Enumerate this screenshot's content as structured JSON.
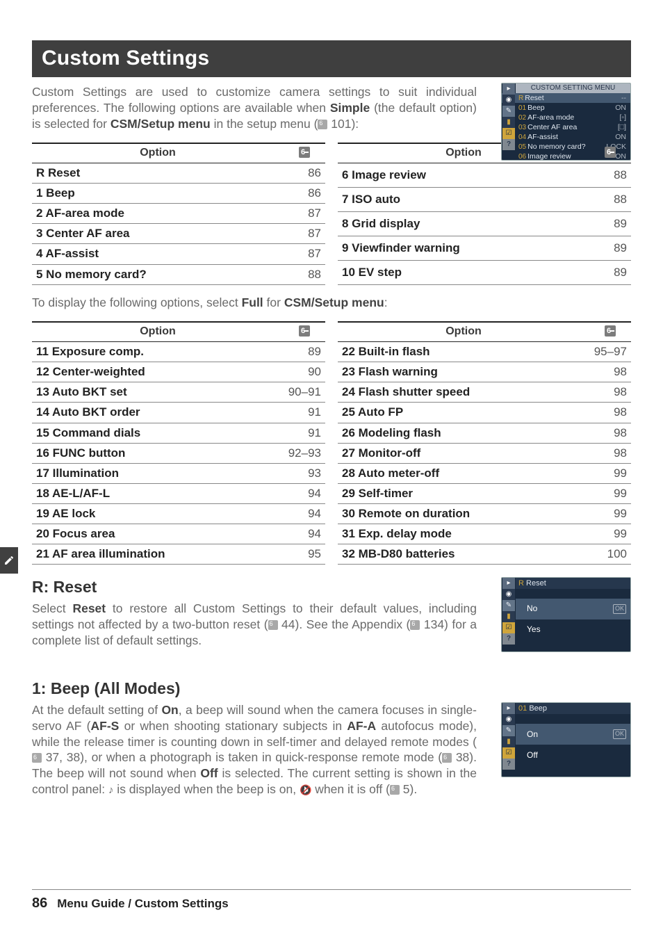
{
  "title": "Custom Settings",
  "intro_parts": {
    "p1": "Custom Settings are used to customize camera settings to suit individual preferences.  The following options are available when ",
    "p1b": "Simple",
    "p2": " (the default option) is selected for ",
    "p2b": "CSM/Setup menu",
    "p3": " in the setup menu (",
    "p3ref": " 101):"
  },
  "lcd1": {
    "title": "CUSTOM SETTING MENU",
    "rows": [
      {
        "n": "R",
        "label": "Reset",
        "val": "--"
      },
      {
        "n": "01",
        "label": "Beep",
        "val": "ON"
      },
      {
        "n": "02",
        "label": "AF-area mode",
        "val": "[▫]"
      },
      {
        "n": "03",
        "label": "Center AF area",
        "val": "[□]"
      },
      {
        "n": "04",
        "label": "AF-assist",
        "val": "ON"
      },
      {
        "n": "05",
        "label": "No memory card?",
        "val": "LOCK"
      },
      {
        "n": "06",
        "label": "Image review",
        "val": "ON"
      }
    ]
  },
  "table_head": {
    "opt": "Option"
  },
  "simple_left": [
    {
      "label": "R Reset",
      "pg": "86"
    },
    {
      "label": "1 Beep",
      "pg": "86"
    },
    {
      "label": "2 AF-area mode",
      "pg": "87"
    },
    {
      "label": "3 Center AF area",
      "pg": "87"
    },
    {
      "label": "4 AF-assist",
      "pg": "87"
    },
    {
      "label": "5 No memory card?",
      "pg": "88"
    }
  ],
  "simple_right": [
    {
      "label": "6 Image review",
      "pg": "88"
    },
    {
      "label": "7 ISO auto",
      "pg": "88"
    },
    {
      "label": "8 Grid display",
      "pg": "89"
    },
    {
      "label": "9 Viewfinder warning",
      "pg": "89"
    },
    {
      "label": "10 EV step",
      "pg": "89"
    }
  ],
  "midline": {
    "p1": "To display the following options, select ",
    "b1": "Full",
    "p2": " for ",
    "b2": "CSM/Setup menu",
    "p3": ":"
  },
  "full_left": [
    {
      "label": "11 Exposure comp.",
      "pg": "89"
    },
    {
      "label": "12 Center-weighted",
      "pg": "90"
    },
    {
      "label": "13 Auto BKT set",
      "pg": "90–91"
    },
    {
      "label": "14 Auto BKT order",
      "pg": "91"
    },
    {
      "label": "15 Command dials",
      "pg": "91"
    },
    {
      "label": "16 FUNC button",
      "pg": "92–93"
    },
    {
      "label": "17 Illumination",
      "pg": "93"
    },
    {
      "label": "18 AE-L/AF-L",
      "pg": "94"
    },
    {
      "label": "19 AE lock",
      "pg": "94"
    },
    {
      "label": "20 Focus area",
      "pg": "94"
    },
    {
      "label": "21 AF area illumination",
      "pg": "95"
    }
  ],
  "full_right": [
    {
      "label": "22 Built-in flash",
      "pg": "95–97"
    },
    {
      "label": "23 Flash warning",
      "pg": "98"
    },
    {
      "label": "24 Flash shutter speed",
      "pg": "98"
    },
    {
      "label": "25 Auto FP",
      "pg": "98"
    },
    {
      "label": "26 Modeling flash",
      "pg": "98"
    },
    {
      "label": "27 Monitor-off",
      "pg": "98"
    },
    {
      "label": "28 Auto meter-off",
      "pg": "99"
    },
    {
      "label": "29 Self-timer",
      "pg": "99"
    },
    {
      "label": "30 Remote on duration",
      "pg": "99"
    },
    {
      "label": "31 Exp. delay mode",
      "pg": "99"
    },
    {
      "label": "32 MB-D80 batteries",
      "pg": "100"
    }
  ],
  "reset": {
    "heading": "R: Reset",
    "p1": "Select ",
    "b1": "Reset",
    "p2": " to restore all Custom Settings to their default values, including settings not affected by a two-button reset (",
    "ref1": " 44).  See the Appendix (",
    "ref2": " 134) for a complete list of default settings."
  },
  "lcd_reset": {
    "title_n": "R",
    "title": "Reset",
    "no": "No",
    "yes": "Yes"
  },
  "beep": {
    "heading": "1: Beep (All Modes)",
    "p1": "At the default setting of ",
    "b1": "On",
    "p2": ", a beep will sound when the camera focuses in single-servo AF (",
    "b2": "AF-S",
    "p3": " or when shooting stationary subjects in ",
    "b3": "AF-A",
    "p4": " autofocus mode), while the release timer is counting down in self-timer and delayed remote modes (",
    "ref1": " 37, 38), or when a photograph is taken in quick-response remote mode (",
    "ref2": " 38).  The beep will not sound when ",
    "b4": "Off",
    "p5": " is selected.  The current setting is shown in the control panel: ",
    "p6": " is displayed when the beep is on, ",
    "p7": " when it is off (",
    "ref3": " 5)."
  },
  "lcd_beep": {
    "title_n": "01",
    "title": "Beep",
    "on": "On",
    "off": "Off"
  },
  "footer": {
    "page": "86",
    "path": "Menu Guide / Custom Settings"
  }
}
